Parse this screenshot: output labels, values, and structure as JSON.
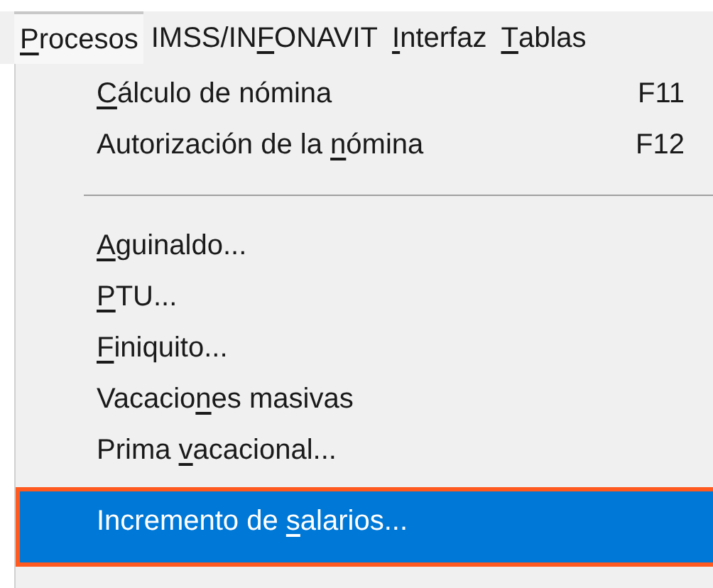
{
  "menu_bar": [
    {
      "label": {
        "key": "P",
        "post": "rocesos"
      },
      "selected": true
    },
    {
      "label": {
        "pre": "IMSS/IN",
        "key": "F",
        "post": "ONAVIT"
      },
      "selected": false
    },
    {
      "label": {
        "key": "I",
        "post": "nterfaz"
      },
      "selected": false
    },
    {
      "label": {
        "key": "T",
        "post": "ablas"
      },
      "selected": false
    }
  ],
  "menu": [
    {
      "kind": "item",
      "label": {
        "key": "C",
        "post": "álculo de nómina"
      },
      "shortcut": "F11",
      "selected": false
    },
    {
      "kind": "item",
      "label": {
        "pre": "Autorización de la ",
        "key": "n",
        "post": "ómina"
      },
      "shortcut": "F12",
      "selected": false
    },
    {
      "kind": "separator"
    },
    {
      "kind": "item",
      "label": {
        "key": "A",
        "post": "guinaldo..."
      },
      "selected": false
    },
    {
      "kind": "item",
      "label": {
        "key": "P",
        "post": "TU..."
      },
      "selected": false
    },
    {
      "kind": "item",
      "label": {
        "key": "F",
        "post": "iniquito..."
      },
      "selected": false
    },
    {
      "kind": "item",
      "label": {
        "pre": "Vacacio",
        "key": "n",
        "post": "es masivas"
      },
      "selected": false
    },
    {
      "kind": "item",
      "label": {
        "pre": "Prima ",
        "key": "v",
        "post": "acacional..."
      },
      "selected": false
    },
    {
      "kind": "item",
      "label": {
        "pre": "Incremento de ",
        "key": "s",
        "post": "alarios..."
      },
      "selected": true
    }
  ]
}
